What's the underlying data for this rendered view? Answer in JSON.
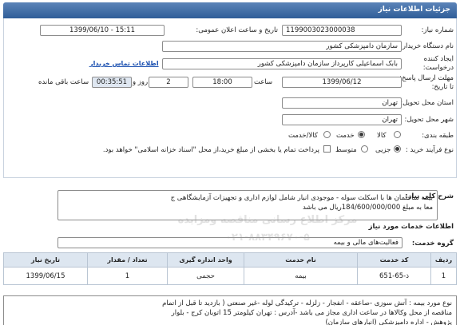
{
  "header": {
    "title": "جزئیات اطلاعات نیاز"
  },
  "form": {
    "need_number": {
      "label": "شماره نیاز:",
      "value": "1199003023000038"
    },
    "announce_datetime": {
      "label": "تاریخ و ساعت اعلان عمومی:",
      "value": "1399/06/10 - 15:11"
    },
    "buyer_name": {
      "label": "نام دستگاه خریدار:",
      "value": "سازمان دامپزشکی کشور"
    },
    "requester": {
      "label": "ایجاد کننده درخواست:",
      "value": "بابک اسماعیلی کارپرداز سازمان دامپزشکی کشور"
    },
    "contact_link": "اطلاعات تماس خریدار",
    "deadline": {
      "label": "مهلت ارسال پاسخ: تا تاریخ:",
      "date": "1399/06/12",
      "time_label": "ساعت",
      "time": "18:00",
      "days": "2",
      "days_label": "روز و",
      "remaining": "00:35:51",
      "remaining_label": "ساعت باقی مانده"
    },
    "province": {
      "label": "استان محل تحویل:",
      "value": "تهران"
    },
    "city": {
      "label": "شهر محل تحویل:",
      "value": "تهران"
    },
    "category": {
      "label": "طبقه بندی:",
      "options": [
        "کالا",
        "خدمت",
        "کالا/خدمت"
      ],
      "selected": "خدمت"
    },
    "process": {
      "label": "نوع فرآیند خرید :",
      "options": [
        "جزیی",
        "متوسط"
      ],
      "selected": "جزیی",
      "note": "پرداخت تمام یا بخشی از مبلغ خرید،از محل \"اسناد خزانه اسلامی\" خواهد بود."
    }
  },
  "summary": {
    "label": "شرح کلی نیاز:",
    "text_line1": "بیمه ساختمان ها با اسکلت سوله - موجودی انبار شامل لوازم اداری و تجهیزات آزمایشگاهی ج",
    "text_line2": "معا به مبلغ 184/600/000/000ریال می باشد"
  },
  "services_title": "اطلاعات خدمات مورد نیاز",
  "service_group": {
    "label": "گروه خدمت:",
    "value": "فعالیت‌های مالی و بیمه"
  },
  "table": {
    "headers": [
      "ردیف",
      "کد خدمت",
      "نام خدمت",
      "واحد اندازه گیری",
      "تعداد / مقدار",
      "تاریخ نیاز"
    ],
    "rows": [
      [
        "1",
        "ذ-65-651",
        "بیمه",
        "حجمی",
        "1",
        "1399/06/15"
      ]
    ]
  },
  "watermark": {
    "line1": "مرکز اطلاع رسانی مناقصه ومزایده",
    "line2": "۰۲۱-۸۸۳۴۹۶۷۰-۵"
  },
  "notes": {
    "line1": "نوع مورد بیمه : آتش سوزی -صاعقه - انفجار - زلزله - ترکیدگی لوله -غیر صنعتی ( بازدید تا قبل از اتمام",
    "line2": "مناقصه از محل وکالاها در ساعت اداری مجاز می باشد -آدرس : تهران کیلومتر 15 اتوبان کرج  - بلوار",
    "line3": "پژوهش - اداره دامپزشکی (انبارهای سازمان)"
  }
}
